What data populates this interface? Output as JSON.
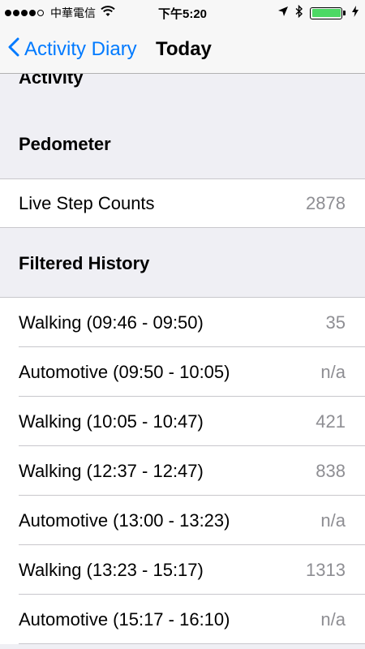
{
  "status_bar": {
    "carrier": "中華電信",
    "time": "下午5:20",
    "battery_level": 1.0,
    "colors": {
      "battery": "#4cd964"
    }
  },
  "nav": {
    "back_label": "Activity Diary",
    "title": "Today",
    "accent_color": "#007aff"
  },
  "sections": {
    "activity_header": "Activity",
    "pedometer_header": "Pedometer",
    "live_step": {
      "label": "Live Step Counts",
      "value": "2878"
    },
    "filtered_header": "Filtered History"
  },
  "history": [
    {
      "label": "Walking (09:46 - 09:50)",
      "value": "35"
    },
    {
      "label": "Automotive (09:50 - 10:05)",
      "value": "n/a"
    },
    {
      "label": "Walking (10:05 - 10:47)",
      "value": "421"
    },
    {
      "label": "Walking (12:37 - 12:47)",
      "value": "838"
    },
    {
      "label": "Automotive (13:00 - 13:23)",
      "value": "n/a"
    },
    {
      "label": "Walking (13:23 - 15:17)",
      "value": "1313"
    },
    {
      "label": "Automotive (15:17 - 16:10)",
      "value": "n/a"
    }
  ]
}
